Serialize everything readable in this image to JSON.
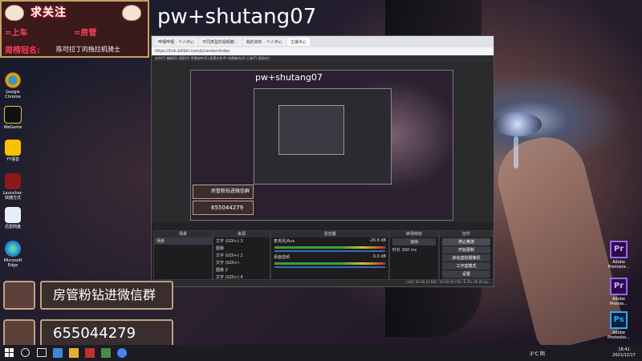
{
  "watermark": "pw+shutang07",
  "banner": {
    "title": "求关注",
    "sub1": "=上车",
    "sub2": "=房管",
    "crown_label": "周榜冠名:",
    "crown_value": "陈可拉丁的拖拉机骑士"
  },
  "desktop_icons": [
    {
      "label": "Google Chrome",
      "color": "#4285f4",
      "icon": "chrome-icon"
    },
    {
      "label": "WeGame",
      "color": "#1a1a1a",
      "icon": "wegame-icon"
    },
    {
      "label": "YY语音",
      "color": "#f5c400",
      "icon": "yy-icon"
    },
    {
      "label": "Launcher-快捷方式",
      "color": "#8a1a1a",
      "icon": "launcher-icon"
    },
    {
      "label": "迅雷网盘",
      "color": "#e8eef8",
      "icon": "cloud-drive-icon"
    },
    {
      "label": "Microsoft Edge",
      "color": "#1e88d8",
      "icon": "edge-icon"
    }
  ],
  "right_icons": [
    {
      "label": "Adobe Premiere...",
      "glyph": "Pr",
      "color": "#9a66ff"
    },
    {
      "label": "Adobe Premie...",
      "glyph": "Pr",
      "color": "#9a66ff"
    },
    {
      "label": "Adobe Photosho...",
      "glyph": "Ps",
      "color": "#31a8ff"
    }
  ],
  "browser_tabs": [
    {
      "label": "哔哩哔哩 - 个人中心"
    },
    {
      "label": "不同类型的视频教..."
    },
    {
      "label": "我的资料 - 个人中心"
    },
    {
      "label": "主播中心"
    }
  ],
  "address_bar": "https://link.bilibili.com/p/center/index",
  "obs": {
    "menu": "文件(F) 编辑(E) 视图(V) 停靠部件(D) 配置文件(P) 场景集合(S) 工具(T) 帮助(H)",
    "scenes_header": "场景",
    "sources_header": "来源",
    "mixer_header": "混音器",
    "transition_header": "转场特效",
    "controls_header": "控件",
    "scene_item": "场景",
    "sources": [
      "文字 (GDI+) 3",
      "图像",
      "文字 (GDI+) 2",
      "文字 (GDI+)",
      "图像 2",
      "文字 (GDI+) 4"
    ],
    "mixer_tracks": [
      "麦克风/Aux",
      "桌面音频"
    ],
    "mixer_db": [
      "-26.8 dB",
      "0.0 dB"
    ],
    "transition": "淡出",
    "duration_label": "时长",
    "duration_value": "300 ms",
    "controls": [
      "停止推流",
      "开始录制",
      "启动虚拟摄像机",
      "工作室模式",
      "设置",
      "退出"
    ],
    "status": "LIVE: 00:36:14   REC: 00:00:00   CPU: 8.3%, 60.00 fps"
  },
  "panels": {
    "group_label": "房管粉钻进微信群",
    "qq_number": "655044279"
  },
  "taskbar": {
    "weather": "3°C 阴",
    "time": "18:41",
    "date": "2021/12/17"
  }
}
